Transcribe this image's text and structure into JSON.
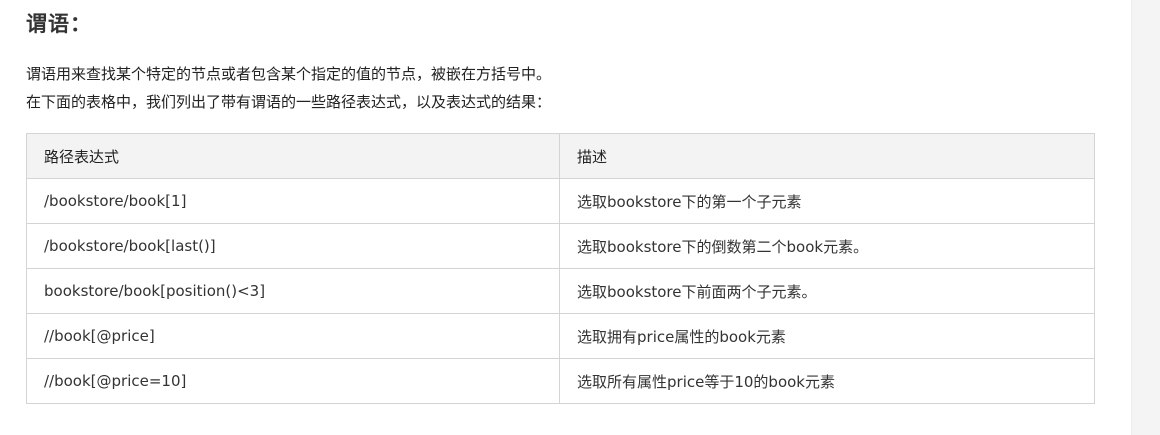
{
  "heading": "谓语：",
  "paragraphs": [
    "谓语用来查找某个特定的节点或者包含某个指定的值的节点，被嵌在方括号中。",
    "在下面的表格中，我们列出了带有谓语的一些路径表达式，以及表达式的结果："
  ],
  "table": {
    "headers": [
      "路径表达式",
      "描述"
    ],
    "rows": [
      [
        "/bookstore/book[1]",
        "选取bookstore下的第一个子元素"
      ],
      [
        "/bookstore/book[last()]",
        "选取bookstore下的倒数第二个book元素。"
      ],
      [
        "bookstore/book[position()<3]",
        "选取bookstore下前面两个子元素。"
      ],
      [
        "//book[@price]",
        "选取拥有price属性的book元素"
      ],
      [
        "//book[@price=10]",
        "选取所有属性price等于10的book元素"
      ]
    ]
  }
}
